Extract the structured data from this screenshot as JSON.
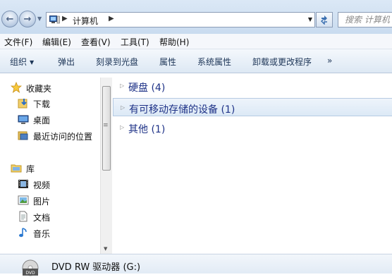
{
  "address": {
    "location": "计算机",
    "search_placeholder": "搜索 计算机"
  },
  "menu": [
    {
      "label": "文件(F)"
    },
    {
      "label": "编辑(E)"
    },
    {
      "label": "查看(V)"
    },
    {
      "label": "工具(T)"
    },
    {
      "label": "帮助(H)"
    }
  ],
  "commands": [
    {
      "label": "组织"
    },
    {
      "label": "弹出"
    },
    {
      "label": "刻录到光盘"
    },
    {
      "label": "属性"
    },
    {
      "label": "系统属性"
    },
    {
      "label": "卸载或更改程序"
    },
    {
      "label": "»"
    }
  ],
  "nav": {
    "favorites": {
      "label": "收藏夹",
      "items": [
        {
          "label": "下载"
        },
        {
          "label": "桌面"
        },
        {
          "label": "最近访问的位置"
        }
      ]
    },
    "library": {
      "label": "库",
      "items": [
        {
          "label": "视频"
        },
        {
          "label": "图片"
        },
        {
          "label": "文档"
        },
        {
          "label": "音乐"
        }
      ]
    }
  },
  "groups": [
    {
      "label": "硬盘 (4)"
    },
    {
      "label": "有可移动存储的设备 (1)"
    },
    {
      "label": "其他 (1)"
    }
  ],
  "details": {
    "label": "DVD RW 驱动器 (G:)",
    "icon_text": "DVD"
  }
}
